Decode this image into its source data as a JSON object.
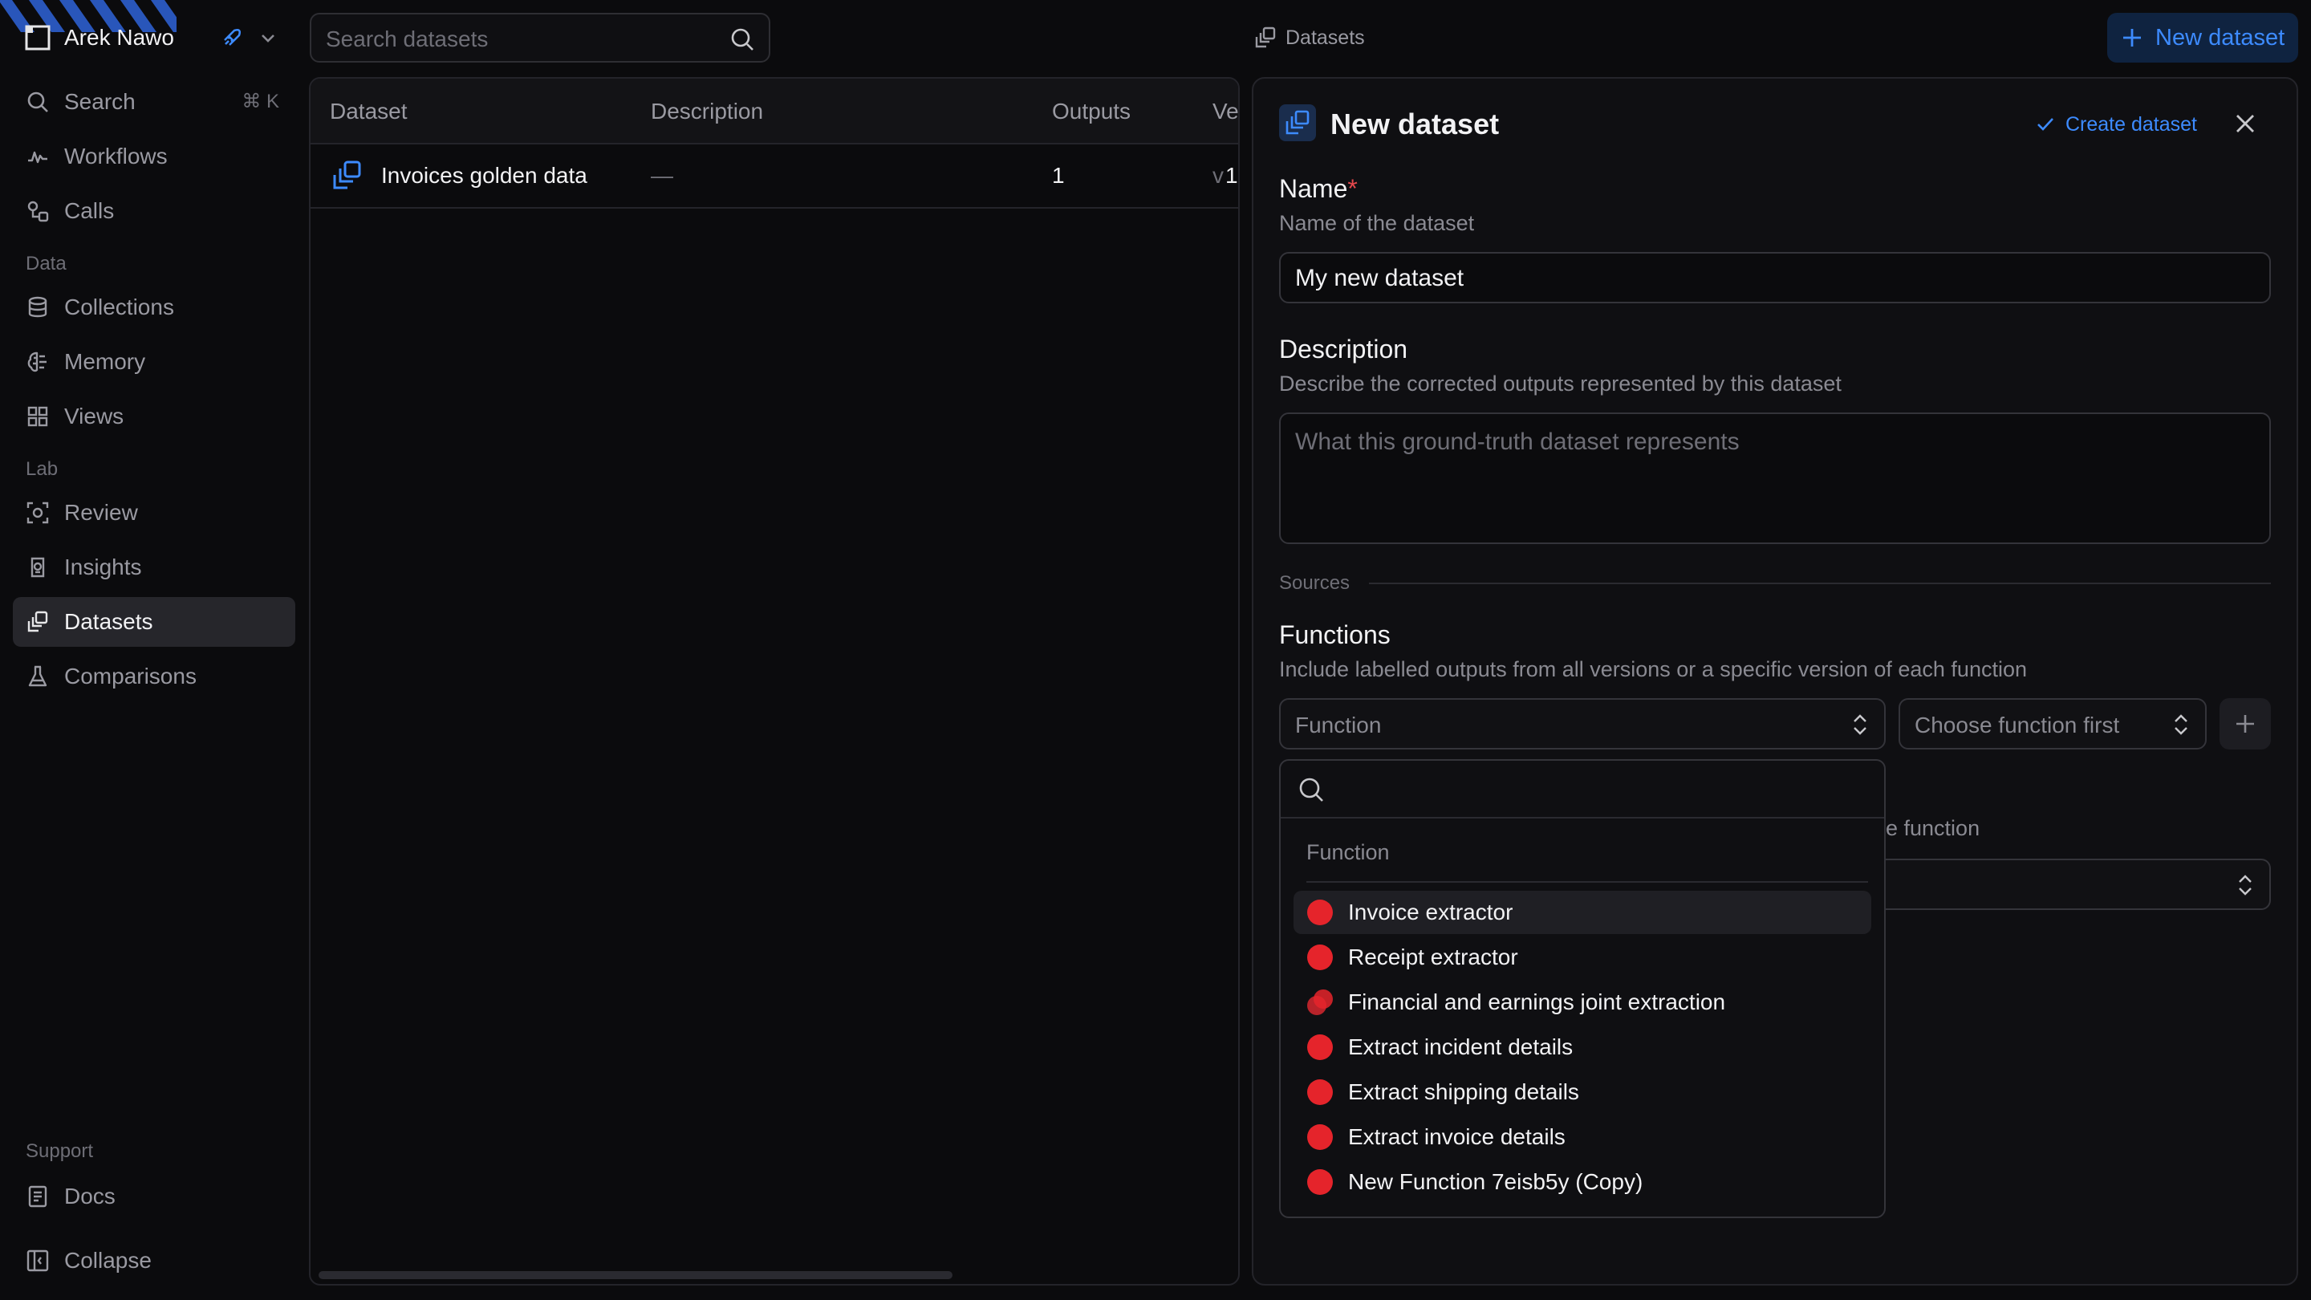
{
  "workspace": {
    "name": "Arek Nawo"
  },
  "sidebar": {
    "search": {
      "label": "Search",
      "shortcut": "⌘ K"
    },
    "top_items": [
      {
        "label": "Workflows",
        "icon": "workflow-icon"
      },
      {
        "label": "Calls",
        "icon": "calls-icon"
      }
    ],
    "sections": {
      "data": "Data",
      "lab": "Lab",
      "support": "Support"
    },
    "data_items": [
      {
        "label": "Collections",
        "icon": "database-icon"
      },
      {
        "label": "Memory",
        "icon": "brain-icon"
      },
      {
        "label": "Views",
        "icon": "grid-icon"
      }
    ],
    "lab_items": [
      {
        "label": "Review",
        "icon": "review-icon"
      },
      {
        "label": "Insights",
        "icon": "insights-icon"
      },
      {
        "label": "Datasets",
        "icon": "datasets-icon",
        "active": true
      },
      {
        "label": "Comparisons",
        "icon": "flask-icon"
      }
    ],
    "support_items": [
      {
        "label": "Docs",
        "icon": "docs-icon"
      },
      {
        "label": "Collapse",
        "icon": "collapse-icon"
      }
    ]
  },
  "topbar": {
    "search_placeholder": "Search datasets",
    "breadcrumb": "Datasets",
    "new_button": "New dataset"
  },
  "table": {
    "columns": [
      "Dataset",
      "Description",
      "Outputs",
      "Ve"
    ],
    "rows": [
      {
        "dataset": "Invoices golden data",
        "description": "—",
        "outputs": "1",
        "version_prefix": "v",
        "version": "1"
      }
    ]
  },
  "panel": {
    "title": "New dataset",
    "create_label": "Create dataset",
    "name_label": "Name",
    "required_mark": "*",
    "name_help": "Name of the dataset",
    "name_value": "My new dataset",
    "description_label": "Description",
    "description_help": "Describe the corrected outputs represented by this dataset",
    "description_placeholder": "What this ground-truth dataset represents",
    "sources_label": "Sources",
    "functions_label": "Functions",
    "functions_help": "Include labelled outputs from all versions or a specific version of each function",
    "function_select": "Function",
    "version_select": "Choose function first",
    "obscured_text": "e function"
  },
  "dropdown": {
    "search_value": "",
    "group_label": "Function",
    "items": [
      "Invoice extractor",
      "Receipt extractor",
      "Financial and earnings joint extraction",
      "Extract incident details",
      "Extract shipping details",
      "Extract invoice details",
      "New Function 7eisb5y (Copy)"
    ]
  },
  "colors": {
    "accent": "#3d8bff",
    "required": "#e5484d",
    "function_dot": "#e5242b"
  }
}
